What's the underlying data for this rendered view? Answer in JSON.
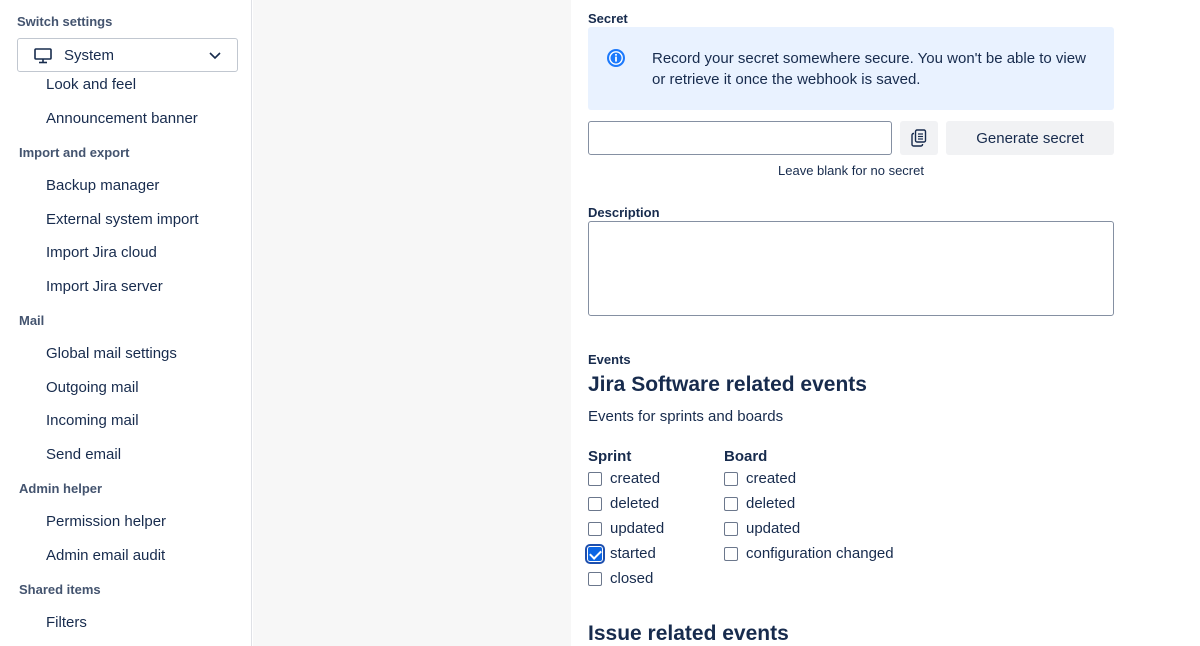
{
  "sidebar": {
    "switch_label": "Switch settings",
    "switch_value": "System",
    "items_top": [
      "Look and feel",
      "Announcement banner"
    ],
    "sections": [
      {
        "title": "Import and export",
        "items": [
          "Backup manager",
          "External system import",
          "Import Jira cloud",
          "Import Jira server"
        ]
      },
      {
        "title": "Mail",
        "items": [
          "Global mail settings",
          "Outgoing mail",
          "Incoming mail",
          "Send email"
        ]
      },
      {
        "title": "Admin helper",
        "items": [
          "Permission helper",
          "Admin email audit"
        ]
      },
      {
        "title": "Shared items",
        "items": [
          "Filters"
        ]
      }
    ]
  },
  "form": {
    "secret_label": "Secret",
    "info_text": "Record your secret somewhere secure. You won't be able to view or retrieve it once the webhook is saved.",
    "secret_value": "",
    "generate_label": "Generate secret",
    "hint": "Leave blank for no secret",
    "description_label": "Description",
    "description_value": "",
    "events_label": "Events",
    "software_heading": "Jira Software related events",
    "software_sub": "Events for sprints and boards",
    "sprint": {
      "heading": "Sprint",
      "options": [
        {
          "label": "created",
          "checked": false
        },
        {
          "label": "deleted",
          "checked": false
        },
        {
          "label": "updated",
          "checked": false
        },
        {
          "label": "started",
          "checked": true
        },
        {
          "label": "closed",
          "checked": false
        }
      ]
    },
    "board": {
      "heading": "Board",
      "options": [
        {
          "label": "created",
          "checked": false
        },
        {
          "label": "deleted",
          "checked": false
        },
        {
          "label": "updated",
          "checked": false
        },
        {
          "label": "configuration changed",
          "checked": false
        }
      ]
    },
    "issue_heading": "Issue related events"
  },
  "colors": {
    "info_bg": "#e9f2ff",
    "accent": "#0c66e4",
    "gutter": "#f7f7f7"
  },
  "icons": [
    "monitor-icon",
    "chevron-down-icon",
    "info-icon",
    "copy-icon"
  ]
}
